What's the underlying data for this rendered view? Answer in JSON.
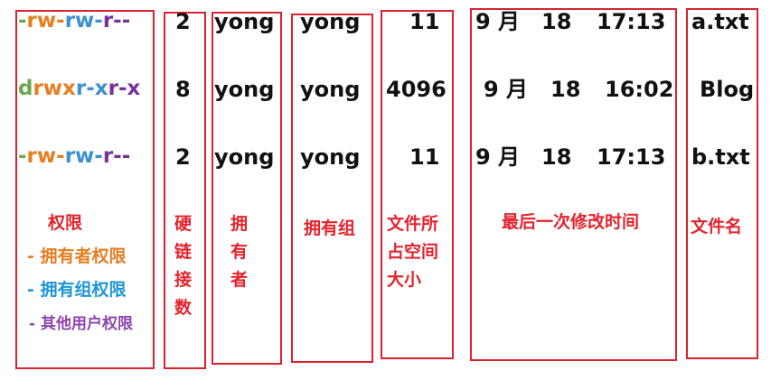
{
  "colors": {
    "border": "#d9232f",
    "label": "#e5232d",
    "type_char": "#6aa84f",
    "owner_perm": "#e67e22",
    "group_perm": "#3d8fd1",
    "other_perm": "#7a2f9a",
    "text": "#111111"
  },
  "rows": [
    {
      "perm": {
        "type": "-",
        "owner": "rw-",
        "group": "rw-",
        "other": "r--"
      },
      "links": "2",
      "owner": "yong",
      "group": "yong",
      "size": "11",
      "month": "9 月",
      "day": "18",
      "time": "17:13",
      "name": "a.txt"
    },
    {
      "perm": {
        "type": "d",
        "owner": "rwx",
        "group": "r-x",
        "other": "r-x"
      },
      "links": "8",
      "owner": "yong",
      "group": "yong",
      "size": "4096",
      "month": "9 月",
      "day": "18",
      "time": "16:02",
      "name": "Blog"
    },
    {
      "perm": {
        "type": "-",
        "owner": "rw-",
        "group": "rw-",
        "other": "r--"
      },
      "links": "2",
      "owner": "yong",
      "group": "yong",
      "size": "11",
      "month": "9 月",
      "day": "18",
      "time": "17:13",
      "name": "b.txt"
    }
  ],
  "labels": {
    "perm_title": "权限",
    "perm_owner": "- 拥有者权限",
    "perm_group": "- 拥有组权限",
    "perm_other": "- 其他用户权限",
    "links": [
      "硬",
      "链",
      "接",
      "数"
    ],
    "owner": [
      "拥",
      "有",
      "者"
    ],
    "group": "拥有组",
    "size": [
      "文件所",
      "占空间",
      "大小"
    ],
    "mtime": "最后一次修改时间",
    "name": "文件名"
  }
}
